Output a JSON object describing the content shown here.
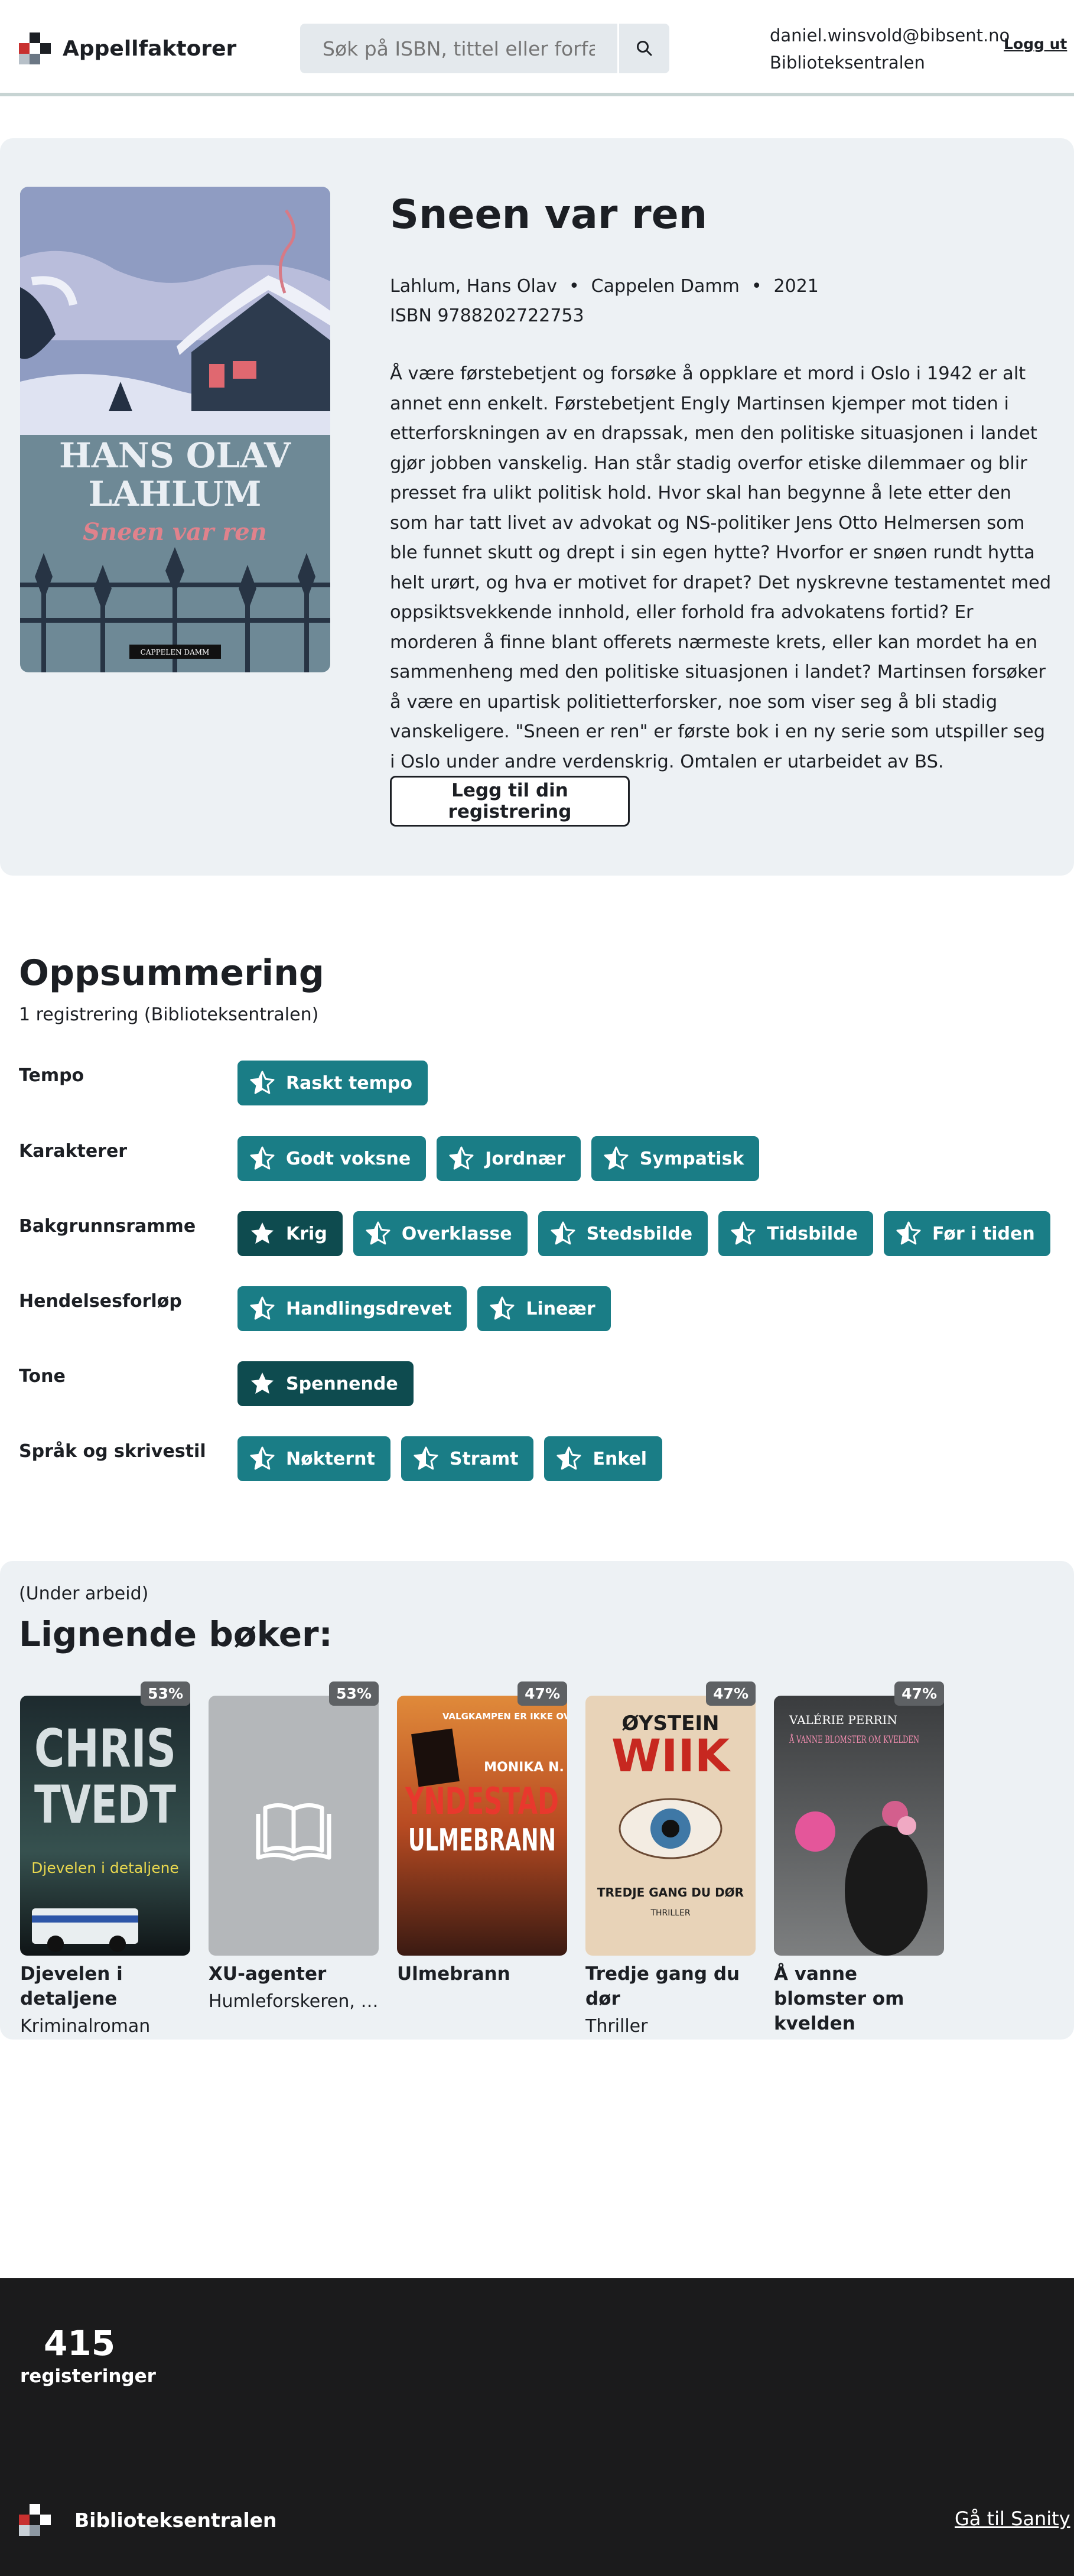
{
  "header": {
    "app_name": "Appellfaktorer",
    "search_placeholder": "Søk på ISBN, tittel eller forfatter",
    "user_email": "daniel.winsvold@bibsent.no",
    "user_org": "Biblioteksentralen",
    "logout_label": "Logg ut"
  },
  "book": {
    "title": "Sneen var ren",
    "author": "Lahlum, Hans Olav",
    "publisher": "Cappelen Damm",
    "year": "2021",
    "isbn": "ISBN 9788202722753",
    "cover": {
      "author": "HANS OLAV\nLAHLUM",
      "title": "Sneen var ren",
      "publisher": "CAPPELEN DAMM"
    },
    "description": "Å være førstebetjent og forsøke å oppklare et mord i Oslo i 1942 er alt annet enn enkelt. Førstebetjent Engly Martinsen kjemper mot tiden i etterforskningen av en drapssak, men den politiske situasjonen i landet gjør jobben vanskelig. Han står stadig overfor etiske dilemmaer og blir presset fra ulikt politisk hold. Hvor skal han begynne å lete etter den som har tatt livet av advokat og NS-politiker Jens Otto Helmersen som ble funnet skutt og drept i sin egen hytte? Hvorfor er snøen rundt hytta helt urørt, og hva er motivet for drapet? Det nyskrevne testamentet med oppsiktsvekkende innhold, eller forhold fra advokatens fortid? Er morderen å finne blant offerets nærmeste krets, eller kan mordet ha en sammenheng med den politiske situasjonen i landet? Martinsen forsøker å være en upartisk politietterforsker, noe som viser seg å bli stadig vanskeligere. \"Sneen er ren\" er første bok i en ny serie som utspiller seg i Oslo under andre verdenskrig. Omtalen er utarbeidet av BS.",
    "add_button": "Legg til din registrering"
  },
  "summary": {
    "title": "Oppsummering",
    "subtitle": "1 registrering (Biblioteksentralen)",
    "rows": [
      {
        "label": "Tempo",
        "tags": [
          {
            "text": "Raskt tempo",
            "selected": false
          }
        ]
      },
      {
        "label": "Karakterer",
        "tags": [
          {
            "text": "Godt voksne",
            "selected": false
          },
          {
            "text": "Jordnær",
            "selected": false
          },
          {
            "text": "Sympatisk",
            "selected": false
          }
        ]
      },
      {
        "label": "Bakgrunnsramme",
        "tags": [
          {
            "text": "Krig",
            "selected": true
          },
          {
            "text": "Overklasse",
            "selected": false
          },
          {
            "text": "Stedsbilde",
            "selected": false
          },
          {
            "text": "Tidsbilde",
            "selected": false
          },
          {
            "text": "Før i tiden",
            "selected": false
          }
        ]
      },
      {
        "label": "Hendelsesforløp",
        "tags": [
          {
            "text": "Handlingsdrevet",
            "selected": false
          },
          {
            "text": "Lineær",
            "selected": false
          }
        ]
      },
      {
        "label": "Tone",
        "tags": [
          {
            "text": "Spennende",
            "selected": true
          }
        ]
      },
      {
        "label": "Språk og skrivestil",
        "tags": [
          {
            "text": "Nøkternt",
            "selected": false
          },
          {
            "text": "Stramt",
            "selected": false
          },
          {
            "text": "Enkel",
            "selected": false
          }
        ]
      }
    ]
  },
  "similar": {
    "note": "(Under arbeid)",
    "title": "Lignende bøker:",
    "books": [
      {
        "title": "Djevelen i detaljene",
        "subtitle": "Kriminalroman",
        "match": "53%",
        "cover_text": [
          "CHRIS",
          "TVEDT",
          "Djevelen i detaljene"
        ]
      },
      {
        "title": "XU-agenter",
        "subtitle": "Humleforskeren, musikeren, ...",
        "match": "53%",
        "cover_text": []
      },
      {
        "title": "Ulmebrann",
        "subtitle": "",
        "match": "47%",
        "cover_text": [
          "VALGKAMPEN ER IKKE OVER",
          "MONIKA N.",
          "YNDESTAD",
          "ULMEBRANN"
        ]
      },
      {
        "title": "Tredje gang du dør",
        "subtitle": "Thriller",
        "match": "47%",
        "cover_text": [
          "ØYSTEIN",
          "WIIK",
          "TREDJE GANG DU DØR",
          "THRILLER"
        ]
      },
      {
        "title": "Å vanne blomster om kvelden",
        "subtitle": "",
        "match": "47%",
        "cover_text": [
          "VALÉRIE PERRIN",
          "Å VANNE BLOMSTER OM KVELDEN"
        ]
      }
    ]
  },
  "footer": {
    "count": "415",
    "count_label": "registeringer",
    "org": "Biblioteksentralen",
    "sanity_link": "Gå til Sanity"
  },
  "colors": {
    "tag": "#1a7d86",
    "tag_selected": "#0e4b4f",
    "panel": "#edf1f4",
    "footer": "#1b1b1c"
  }
}
